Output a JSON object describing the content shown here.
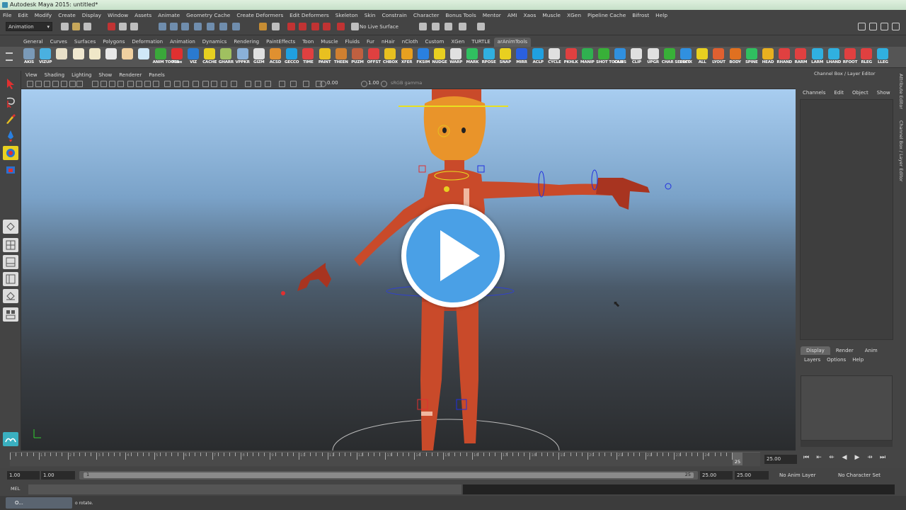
{
  "window": {
    "title": "Autodesk Maya 2015: untitled*"
  },
  "menubar": [
    "File",
    "Edit",
    "Modify",
    "Create",
    "Display",
    "Window",
    "Assets",
    "Animate",
    "Geometry Cache",
    "Create Deformers",
    "Edit Deformers",
    "Skeleton",
    "Skin",
    "Constrain",
    "Character",
    "Bonus Tools",
    "Mentor",
    "AMI",
    "Xaos",
    "Muscle",
    "XGen",
    "Pipeline Cache",
    "Bifrost",
    "Help"
  ],
  "statusline": {
    "mode": "Animation",
    "live_surface": "No Live Surface"
  },
  "shelf_tabs": {
    "items": [
      "General",
      "Curves",
      "Surfaces",
      "Polygons",
      "Deformation",
      "Animation",
      "Dynamics",
      "Rendering",
      "PaintEffects",
      "Toon",
      "Muscle",
      "Fluids",
      "Fur",
      "nHair",
      "nCloth",
      "Custom",
      "XGen",
      "TURTLE",
      "arAnimTools"
    ],
    "active": "arAnimTools"
  },
  "shelf_buttons": [
    {
      "label": "AKIS",
      "color": "#7a9ab8"
    },
    {
      "label": "VIZUP",
      "color": "#4ab0e0"
    },
    {
      "label": "",
      "color": "#e8e0c8"
    },
    {
      "label": "",
      "color": "#f0e8d0"
    },
    {
      "label": "",
      "color": "#f0e8c8"
    },
    {
      "label": "",
      "color": "#e8e8e8"
    },
    {
      "label": "",
      "color": "#f0d0a0"
    },
    {
      "label": "",
      "color": "#d0e8f8"
    },
    {
      "label": "ANIM TOOLS",
      "color": "#3aa83a"
    },
    {
      "label": "TBox",
      "color": "#e03030"
    },
    {
      "label": "VIZ",
      "color": "#2a7ad0"
    },
    {
      "label": "CACHE",
      "color": "#e8d020"
    },
    {
      "label": "GHARR",
      "color": "#a0c060"
    },
    {
      "label": "VPPKR",
      "color": "#8ab0d8"
    },
    {
      "label": "GIZM",
      "color": "#e0e0e0"
    },
    {
      "label": "ACSD",
      "color": "#e09030"
    },
    {
      "label": "GECCO",
      "color": "#20a0e0"
    },
    {
      "label": "TIME",
      "color": "#e04040"
    },
    {
      "label": "PAINT",
      "color": "#e8c020"
    },
    {
      "label": "THEEN",
      "color": "#d08030"
    },
    {
      "label": "PUZM",
      "color": "#c06040"
    },
    {
      "label": "OFFST",
      "color": "#e04040"
    },
    {
      "label": "CHBOX",
      "color": "#e8c020"
    },
    {
      "label": "XFER",
      "color": "#e8a020"
    },
    {
      "label": "FKSIM",
      "color": "#2a80e0"
    },
    {
      "label": "NUDGE",
      "color": "#e8d020"
    },
    {
      "label": "WARP",
      "color": "#e0e0e0"
    },
    {
      "label": "MARK",
      "color": "#30c060"
    },
    {
      "label": "RPOSE",
      "color": "#30b0e0"
    },
    {
      "label": "SNAP",
      "color": "#e8d020"
    },
    {
      "label": "MIRR",
      "color": "#2a60e0"
    },
    {
      "label": "ACLP",
      "color": "#20a0e0"
    },
    {
      "label": "CYCLE",
      "color": "#e0e0e0"
    },
    {
      "label": "PKHLK",
      "color": "#e04040"
    },
    {
      "label": "MANIP",
      "color": "#30b050"
    },
    {
      "label": "SHOT TOOLS",
      "color": "#38b038"
    },
    {
      "label": "CAMS",
      "color": "#3090e0"
    },
    {
      "label": "CLIP",
      "color": "#e0e0e0"
    },
    {
      "label": "UPGR",
      "color": "#e0e0e0"
    },
    {
      "label": "CHAR SELECT",
      "color": "#38b038"
    },
    {
      "label": "PRFIX",
      "color": "#3090e0"
    },
    {
      "label": "ALL",
      "color": "#e8d020"
    },
    {
      "label": "LYOUT",
      "color": "#e06030"
    },
    {
      "label": "BODY",
      "color": "#e07020"
    },
    {
      "label": "SPINE",
      "color": "#30c060"
    },
    {
      "label": "HEAD",
      "color": "#e8b020"
    },
    {
      "label": "RHAND",
      "color": "#e04040"
    },
    {
      "label": "RARM",
      "color": "#e04040"
    },
    {
      "label": "LARM",
      "color": "#30b0e0"
    },
    {
      "label": "LHAND",
      "color": "#30b0e0"
    },
    {
      "label": "RFOOT",
      "color": "#e04040"
    },
    {
      "label": "RLEG",
      "color": "#e04040"
    },
    {
      "label": "LLEG",
      "color": "#30b0e0"
    }
  ],
  "panel_menu": [
    "View",
    "Shading",
    "Lighting",
    "Show",
    "Renderer",
    "Panels"
  ],
  "panel_toolbar": {
    "field1": "0.00",
    "field2": "1.00",
    "gamma": "sRGB gamma"
  },
  "channel_box": {
    "title": "Channel Box / Layer Editor",
    "menu": [
      "Channels",
      "Edit",
      "Object",
      "Show"
    ]
  },
  "side_tabs": [
    "Attribute Editor",
    "Channel Box / Layer Editor"
  ],
  "layer_editor": {
    "tabs": [
      "Display",
      "Render",
      "Anim"
    ],
    "active": "Display",
    "menu": [
      "Layers",
      "Options",
      "Help"
    ]
  },
  "timeline": {
    "ticks": [
      "1",
      "2",
      "3",
      "4",
      "5",
      "6",
      "7",
      "8",
      "9",
      "10",
      "11",
      "12",
      "13",
      "14",
      "15",
      "16",
      "17",
      "18",
      "19",
      "20",
      "21",
      "22",
      "23",
      "24"
    ],
    "current_frame": "25",
    "current_field": "25.00"
  },
  "range": {
    "start": "1.00",
    "start2": "1.00",
    "handle_start": "1",
    "handle_end": "25",
    "end": "25.00",
    "end2": "25.00",
    "anim_layer": "No Anim Layer",
    "character_set": "No Character Set"
  },
  "command": {
    "label": "MEL"
  },
  "help": {
    "text": "o rotate.",
    "task": "O..."
  }
}
